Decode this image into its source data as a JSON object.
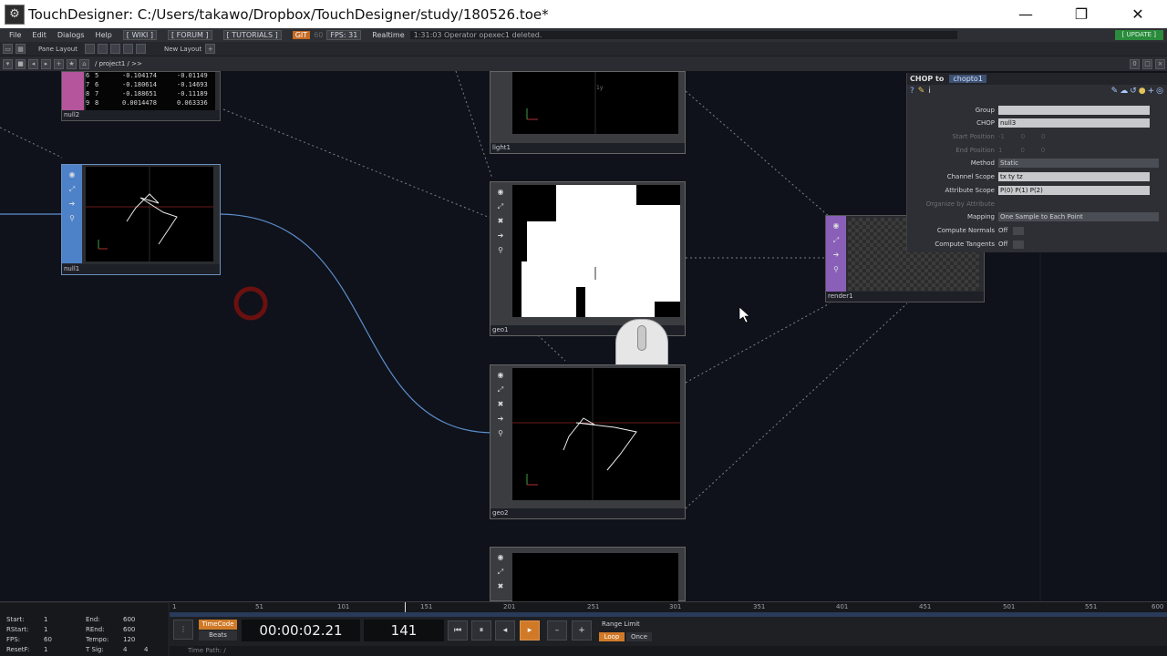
{
  "window": {
    "title": "TouchDesigner: C:/Users/takawo/Dropbox/TouchDesigner/study/180526.toe*",
    "minimize": "—",
    "restore": "❐",
    "close": "✕"
  },
  "menu": {
    "items": [
      "File",
      "Edit",
      "Dialogs",
      "Help"
    ],
    "links": [
      "[ WIKI ]",
      "[ FORUM ]",
      "[ TUTORIALS ]"
    ],
    "git": "GIT",
    "fps_target": "60",
    "fps": "FPS: 31",
    "realtime": "Realtime",
    "status": "1:31:03 Operator opexec1 deleted.",
    "update": "[ UPDATE ]"
  },
  "panebar": {
    "pane_layout": "Pane Layout",
    "new_layout": "New Layout"
  },
  "pathbar": {
    "path": "/ project1 / >>"
  },
  "nodes": {
    "null2": {
      "name": "null2",
      "rows": [
        {
          "i": "6",
          "j": "5",
          "a": "-0.104174",
          "b": "-0.01149"
        },
        {
          "i": "7",
          "j": "6",
          "a": "-0.180614",
          "b": "-0.14693"
        },
        {
          "i": "8",
          "j": "7",
          "a": "-0.188651",
          "b": "-0.11189"
        },
        {
          "i": "9",
          "j": "8",
          "a": "0.0014478",
          "b": "0.063336"
        }
      ]
    },
    "null1": {
      "name": "null1"
    },
    "light1": {
      "name": "light1",
      "axis": "1y"
    },
    "geo1": {
      "name": "geo1"
    },
    "geo2": {
      "name": "geo2"
    },
    "render1": {
      "name": "render1"
    }
  },
  "params": {
    "family": "CHOP to",
    "op_name": "chopto1",
    "rows": [
      {
        "label": "Group",
        "value": "",
        "type": "field",
        "dim": false
      },
      {
        "label": "CHOP",
        "value": "null3",
        "type": "field",
        "dim": false
      },
      {
        "label": "Start Position",
        "value": "-1        0        0",
        "type": "num",
        "dim": true
      },
      {
        "label": "End Position",
        "value": "1         0        0",
        "type": "num",
        "dim": true
      },
      {
        "label": "Method",
        "value": "Static",
        "type": "menu",
        "dim": false
      },
      {
        "label": "Channel Scope",
        "value": "tx ty tz",
        "type": "field",
        "dim": false
      },
      {
        "label": "Attribute Scope",
        "value": "P(0) P(1) P(2)",
        "type": "field",
        "dim": false
      },
      {
        "label": "Organize by Attribute",
        "value": "",
        "type": "none",
        "dim": true
      },
      {
        "label": "Mapping",
        "value": "One Sample to Each Point",
        "type": "menu",
        "dim": false
      },
      {
        "label": "Compute Normals",
        "value": "Off",
        "type": "toggle",
        "dim": false
      },
      {
        "label": "Compute Tangents",
        "value": "Off",
        "type": "toggle",
        "dim": false
      }
    ]
  },
  "timeline": {
    "ticks": [
      "1",
      "51",
      "101",
      "151",
      "201",
      "251",
      "301",
      "351",
      "401",
      "451",
      "501",
      "551",
      "600"
    ],
    "stats": {
      "start_l": "Start:",
      "start_v": "1",
      "rstart_l": "RStart:",
      "rstart_v": "1",
      "fps_l": "FPS:",
      "fps_v": "60",
      "resetf_l": "ResetF:",
      "resetf_v": "1",
      "end_l": "End:",
      "end_v": "600",
      "rend_l": "REnd:",
      "rend_v": "600",
      "tempo_l": "Tempo:",
      "tempo_v": "120",
      "tsig_l": "T Sig:",
      "tsig_a": "4",
      "tsig_b": "4"
    },
    "timecode_tab": "TimeCode",
    "beats_tab": "Beats",
    "timecode": "00:00:02.21",
    "frame": "141",
    "range_limit": "Range Limit",
    "loop": "Loop",
    "once": "Once",
    "time_path": "Time Path: /"
  }
}
